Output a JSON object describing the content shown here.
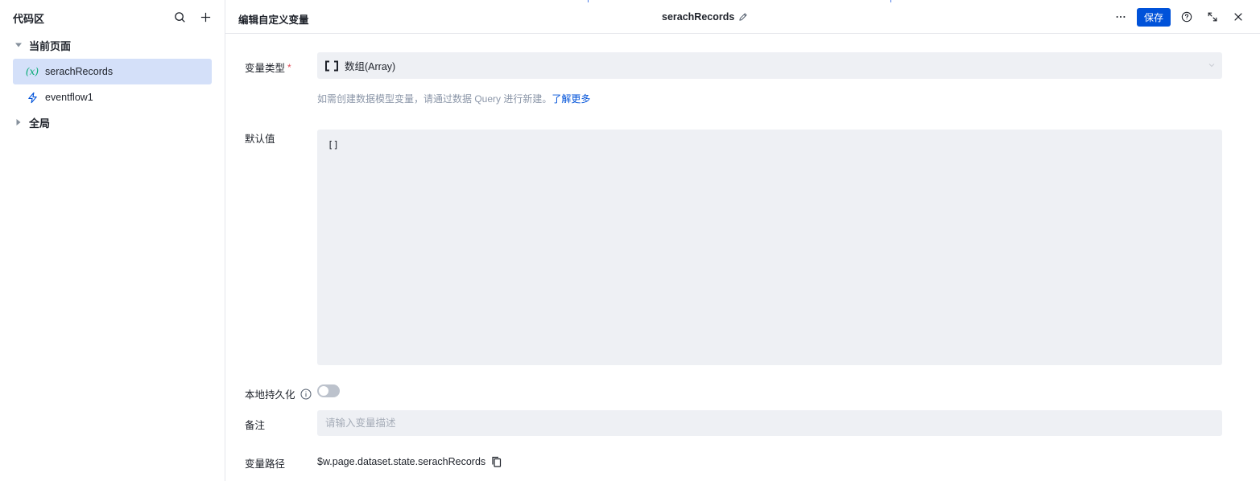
{
  "sidebar": {
    "title": "代码区",
    "groups": [
      {
        "label": "当前页面",
        "items": [
          {
            "label": "serachRecords",
            "icon": "variable-icon",
            "icon_glyph": "(x)",
            "active": true
          },
          {
            "label": "eventflow1",
            "icon": "lightning-icon",
            "active": false
          }
        ]
      },
      {
        "label": "全局",
        "items": []
      }
    ]
  },
  "header": {
    "title": "编辑自定义变量",
    "variable_name": "serachRecords",
    "save_label": "保存"
  },
  "form": {
    "type_label": "变量类型",
    "required_mark": "*",
    "type_value": "数组(Array)",
    "hint_text": "如需创建数据模型变量，请通过数据 Query 进行新建。",
    "hint_link": "了解更多",
    "default_label": "默认值",
    "default_value": "[]",
    "persist_label": "本地持久化",
    "persist_enabled": false,
    "remark_label": "备注",
    "remark_placeholder": "请输入变量描述",
    "remark_value": "",
    "path_label": "变量路径",
    "path_value": "$w.page.dataset.state.serachRecords"
  },
  "colors": {
    "accent": "#0052d9",
    "active_bg": "#d4e0f9",
    "field_bg": "#eef0f4",
    "variable_icon": "#00a870",
    "required": "#e34d59"
  }
}
